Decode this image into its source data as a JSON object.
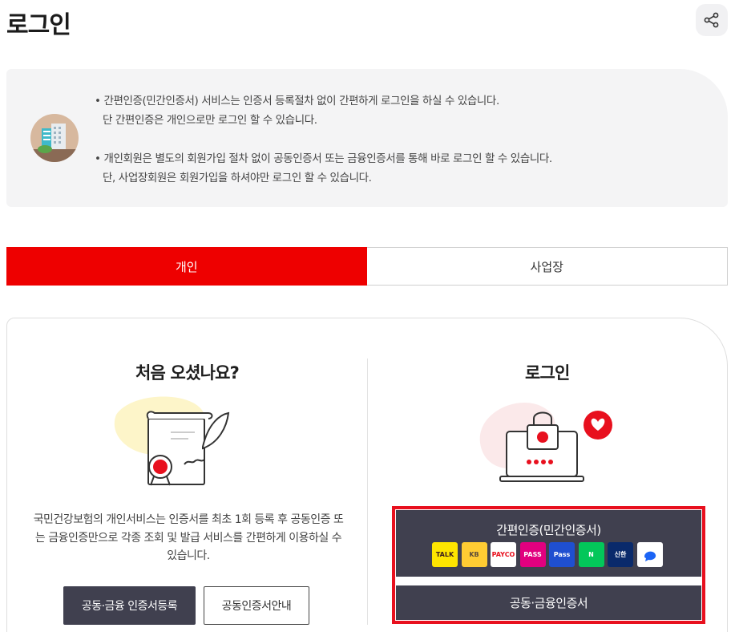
{
  "page": {
    "title": "로그인"
  },
  "notice": {
    "lines": [
      "• 간편인증(민간인증서) 서비스는 인증서 등록절차 없이 간편하게 로그인을 하실 수 있습니다.",
      "   단 간편인증은 개인으로만 로그인 할 수 있습니다.",
      "• 개인회원은 별도의 회원가입 절차 없이 공동인증서 또는 금융인증서를 통해 바로 로그인 할 수 있습니다.",
      "   단, 사업장회원은 회원가입을 하셔야만 로그인 할 수 있습니다."
    ]
  },
  "tabs": [
    {
      "label": "개인",
      "active": true
    },
    {
      "label": "사업장",
      "active": false
    }
  ],
  "left_panel": {
    "title": "처음 오셨나요?",
    "description": "국민건강보험의 개인서비스는 인증서를 최초 1회 등록 후 공동인증 또는 금융인증만으로 각종 조회 및 발급 서비스를 간편하게 이용하실 수 있습니다.",
    "register_button": "공동·금융 인증서등록",
    "guide_button": "공동인증서안내"
  },
  "right_panel": {
    "title": "로그인",
    "simple_auth_label": "간편인증(민간인증서)",
    "providers": [
      {
        "icon": "kakaotalk-icon",
        "text": "TALK",
        "bg": "#fee500",
        "fg": "#3a1d1d"
      },
      {
        "icon": "kb-bank-icon",
        "text": "KB",
        "bg": "#ffcc33",
        "fg": "#5a4a3a"
      },
      {
        "icon": "payco-icon",
        "text": "PAYCO",
        "bg": "#ffffff",
        "fg": "#e8101e"
      },
      {
        "icon": "pass-icon",
        "text": "PASS",
        "bg": "#e1007f",
        "fg": "#ffffff"
      },
      {
        "icon": "samsung-pass-icon",
        "text": "Pass",
        "bg": "#1f4fd0",
        "fg": "#ffffff"
      },
      {
        "icon": "naver-icon",
        "text": "N",
        "bg": "#03c75a",
        "fg": "#ffffff"
      },
      {
        "icon": "shinhan-icon",
        "text": "신한",
        "bg": "#0a2a6b",
        "fg": "#ffffff"
      },
      {
        "icon": "toss-icon",
        "text": "",
        "bg": "#ffffff",
        "fg": "#1b64f5"
      }
    ],
    "cert_button": "공동·금융인증서"
  },
  "colors": {
    "accent": "#ee0000",
    "dark_button": "#40404f",
    "highlight_border": "#e8101e"
  }
}
